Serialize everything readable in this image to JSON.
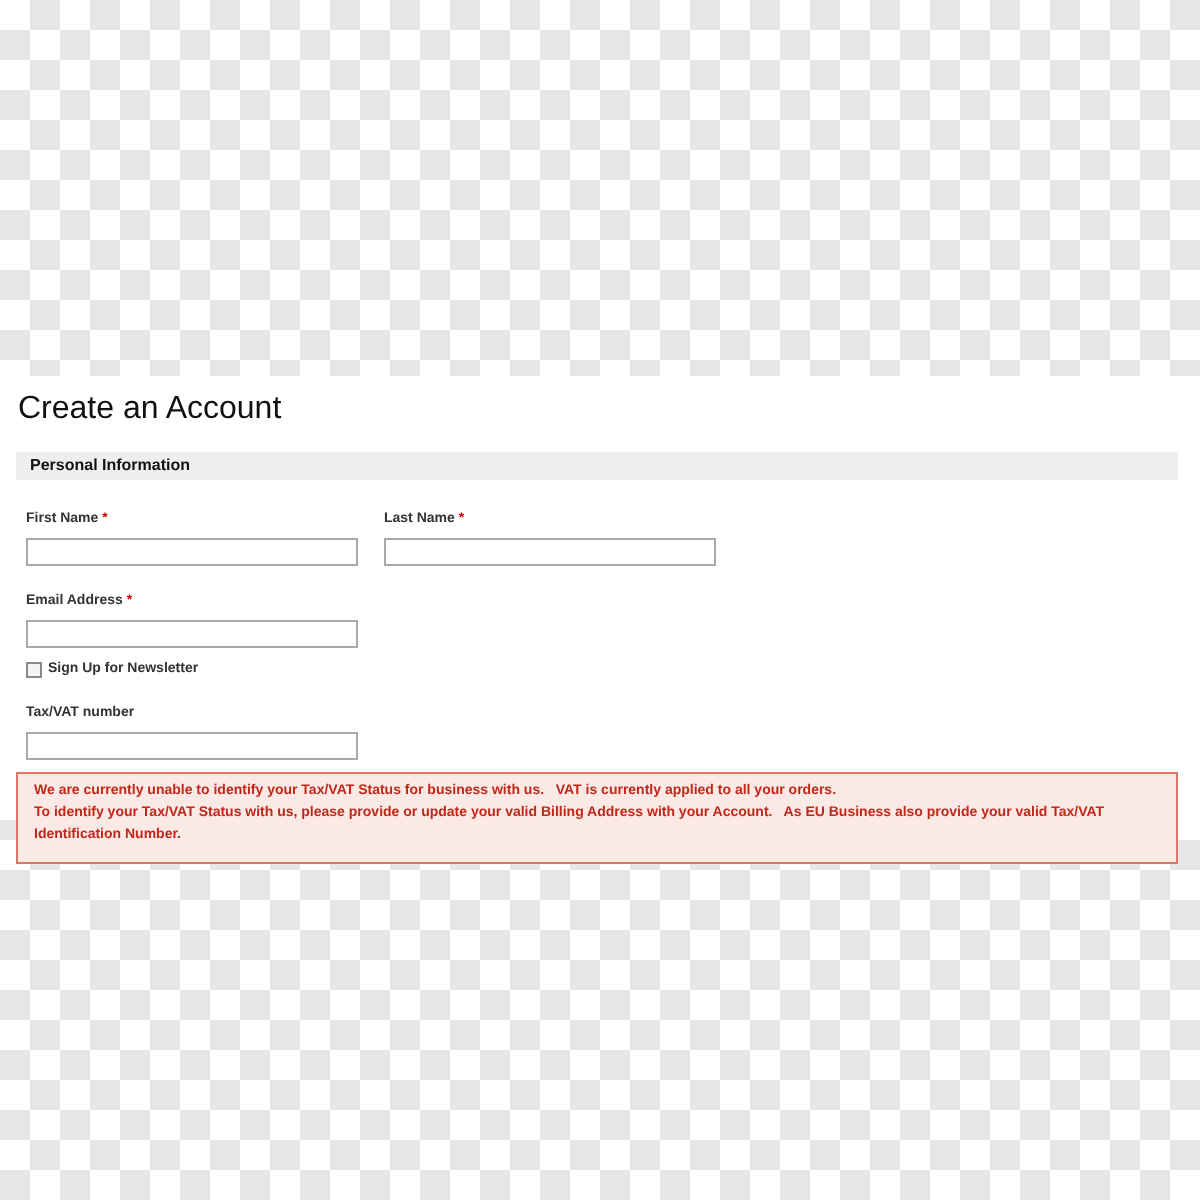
{
  "title": "Create an Account",
  "section": {
    "title": "Personal Information"
  },
  "fields": [
    {
      "label": "First Name",
      "marker": "*"
    },
    {
      "label": "Last Name",
      "marker": "*"
    }
  ],
  "email": {
    "label": "Email Address",
    "marker": "*"
  },
  "newsletter": {
    "label": "Sign Up for Newsletter",
    "checked": false
  },
  "tax": {
    "label": "Tax/VAT number"
  },
  "notice": [
    "We are currently unable to identify your Tax/VAT Status for business with us.   VAT is currently applied to all your orders.",
    "To identify your Tax/VAT Status with us, please provide or update your valid Billing Address with your Account.   As EU Business also provide your valid Tax/VAT Identification Number."
  ]
}
